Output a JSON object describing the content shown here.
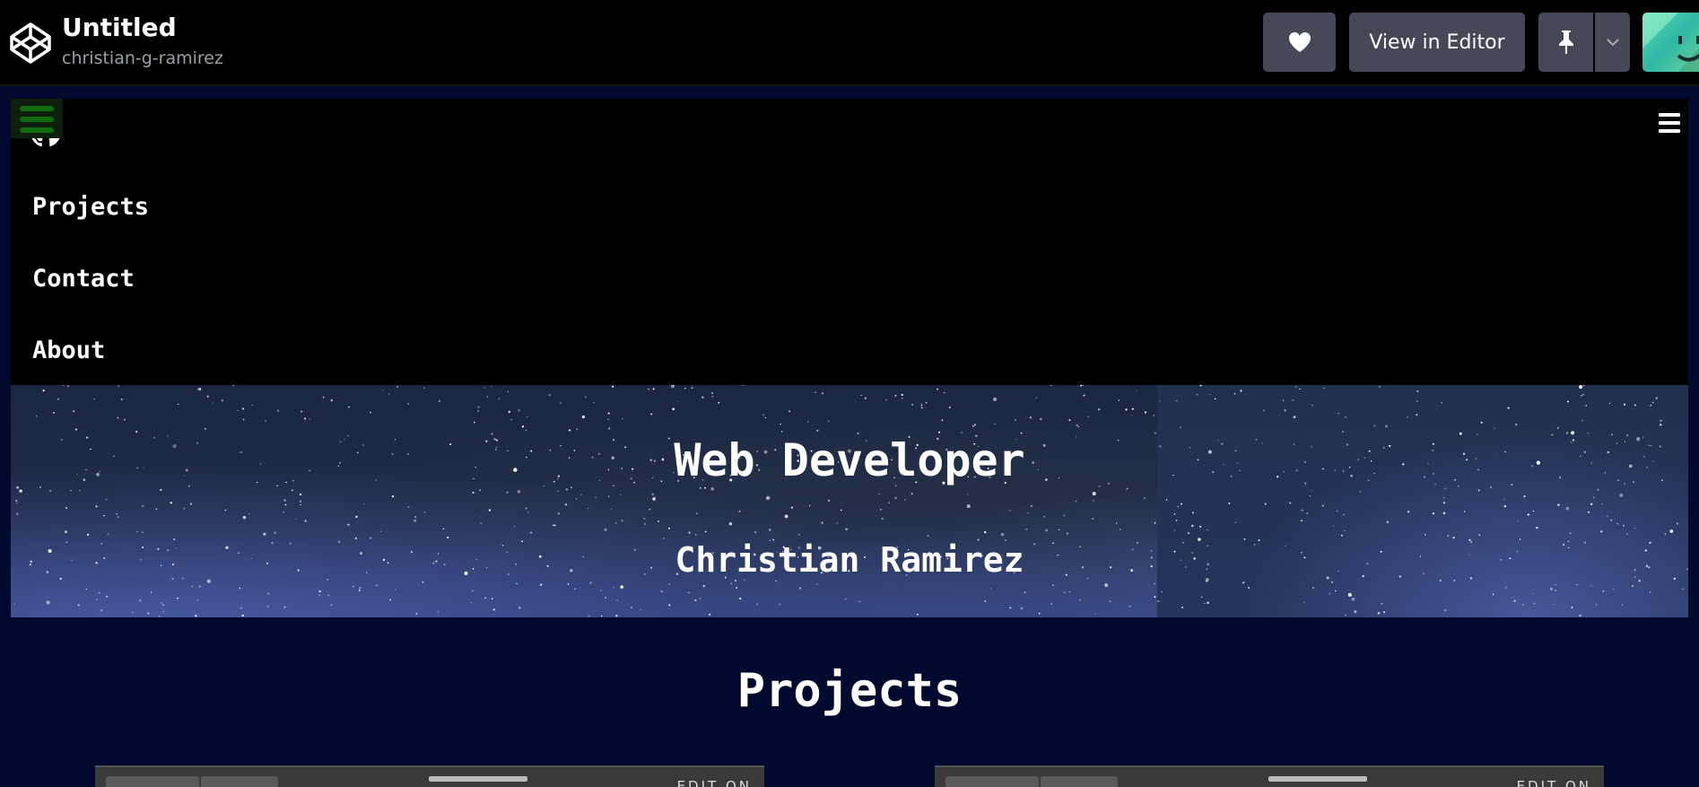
{
  "header": {
    "title": "Untitled",
    "author": "christian-g-ramirez",
    "buttons": {
      "view_in_editor": "View in Editor"
    }
  },
  "preview": {
    "nav": {
      "links": [
        "Projects",
        "Contact",
        "About"
      ]
    },
    "hero": {
      "title": "Web Developer",
      "subtitle": "Christian Ramirez"
    },
    "projects": {
      "heading": "Projects",
      "embeds": [
        {
          "edit_label": "EDIT ON"
        },
        {
          "edit_label": "EDIT ON"
        }
      ]
    }
  }
}
